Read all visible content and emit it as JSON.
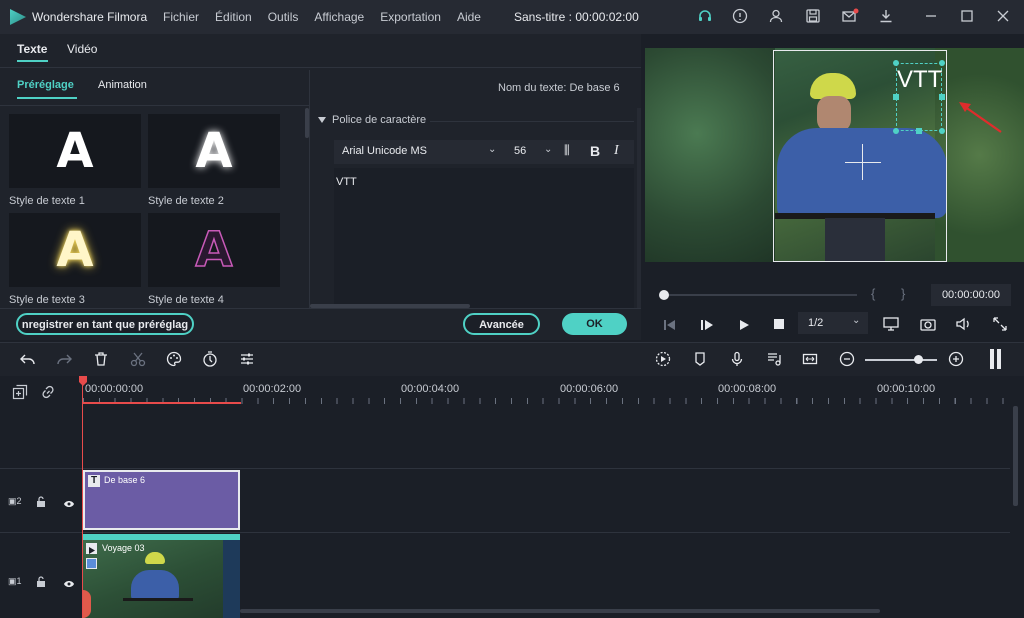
{
  "app": {
    "name": "Wondershare Filmora",
    "doc_title": "Sans-titre : 00:00:02:00"
  },
  "menu": [
    "Fichier",
    "Édition",
    "Outils",
    "Affichage",
    "Exportation",
    "Aide"
  ],
  "top_tabs": {
    "text": "Texte",
    "video": "Vidéo"
  },
  "sub_tabs": {
    "preset": "Préréglage",
    "animation": "Animation"
  },
  "styles": [
    {
      "label": "Style de texte 1",
      "glyph": "A"
    },
    {
      "label": "Style de texte 2",
      "glyph": "A"
    },
    {
      "label": "Style de texte 3",
      "glyph": "A"
    },
    {
      "label": "Style de texte 4",
      "glyph": "A"
    }
  ],
  "text_name": "Nom du texte: De base 6",
  "font_section": "Police de caractère",
  "font": {
    "family": "Arial Unicode MS",
    "size": "56"
  },
  "text_value": "VTT",
  "buttons": {
    "save_preset": "nregistrer en tant que préréglag",
    "advanced": "Avancée",
    "ok": "OK"
  },
  "preview": {
    "overlay_text": "VTT",
    "time": "00:00:00:00",
    "ratio": "1/2"
  },
  "ruler": [
    "00:00:00:00",
    "00:00:02:00",
    "00:00:04:00",
    "00:00:06:00",
    "00:00:08:00",
    "00:00:10:00"
  ],
  "tracks": {
    "t2": {
      "num": "2",
      "clip": "De base 6"
    },
    "t1": {
      "num": "1",
      "clip": "Voyage 03"
    }
  },
  "colors": {
    "accent": "#4fd1c5",
    "text_clip": "#6b5ca5",
    "playhead": "#e84b4b"
  }
}
